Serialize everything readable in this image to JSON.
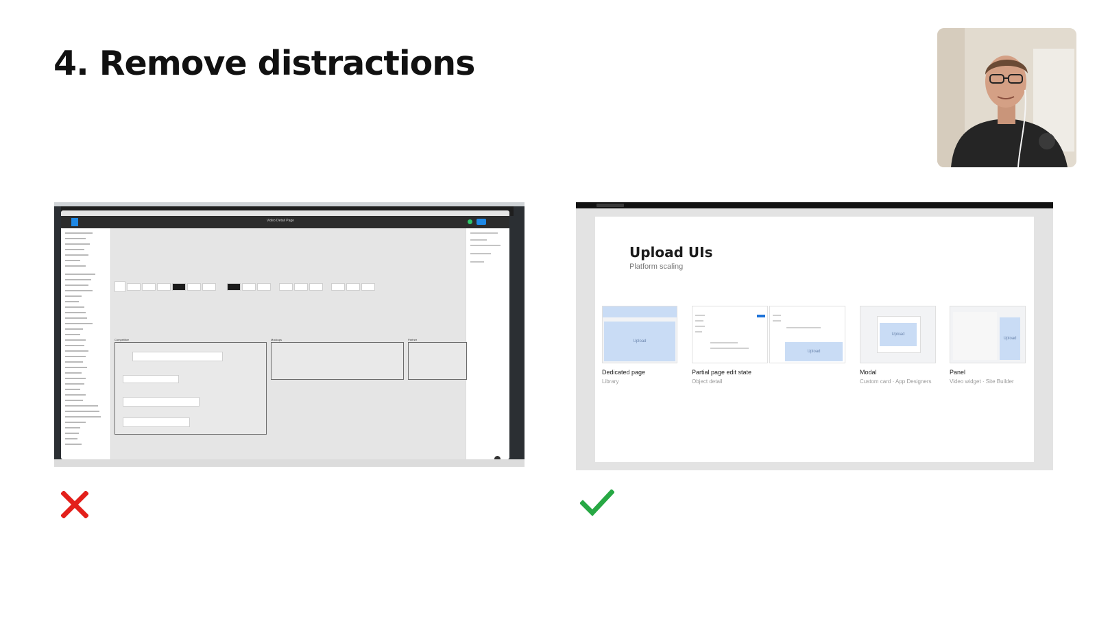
{
  "slide": {
    "title": "4. Remove distractions"
  },
  "bad_example": {
    "mark": "cross-icon",
    "mark_color": "#e3201b",
    "app": "Figma",
    "file_title": "Video Detail Page",
    "canvas_groups": [
      "Competitive",
      "Mockups",
      "Partner"
    ]
  },
  "good_example": {
    "mark": "check-icon",
    "mark_color": "#27a844",
    "page_title": "Upload UIs",
    "page_subtitle": "Platform scaling",
    "upload_label": "Upload",
    "items": [
      {
        "label": "Dedicated page",
        "sublabel": "Library"
      },
      {
        "label": "Partial page edit state",
        "sublabel": "Object detail"
      },
      {
        "label": "Modal",
        "sublabel": "Custom card · App Designers"
      },
      {
        "label": "Panel",
        "sublabel": "Video widget · Site Builder"
      }
    ],
    "accent_color": "#c9dcf5"
  }
}
